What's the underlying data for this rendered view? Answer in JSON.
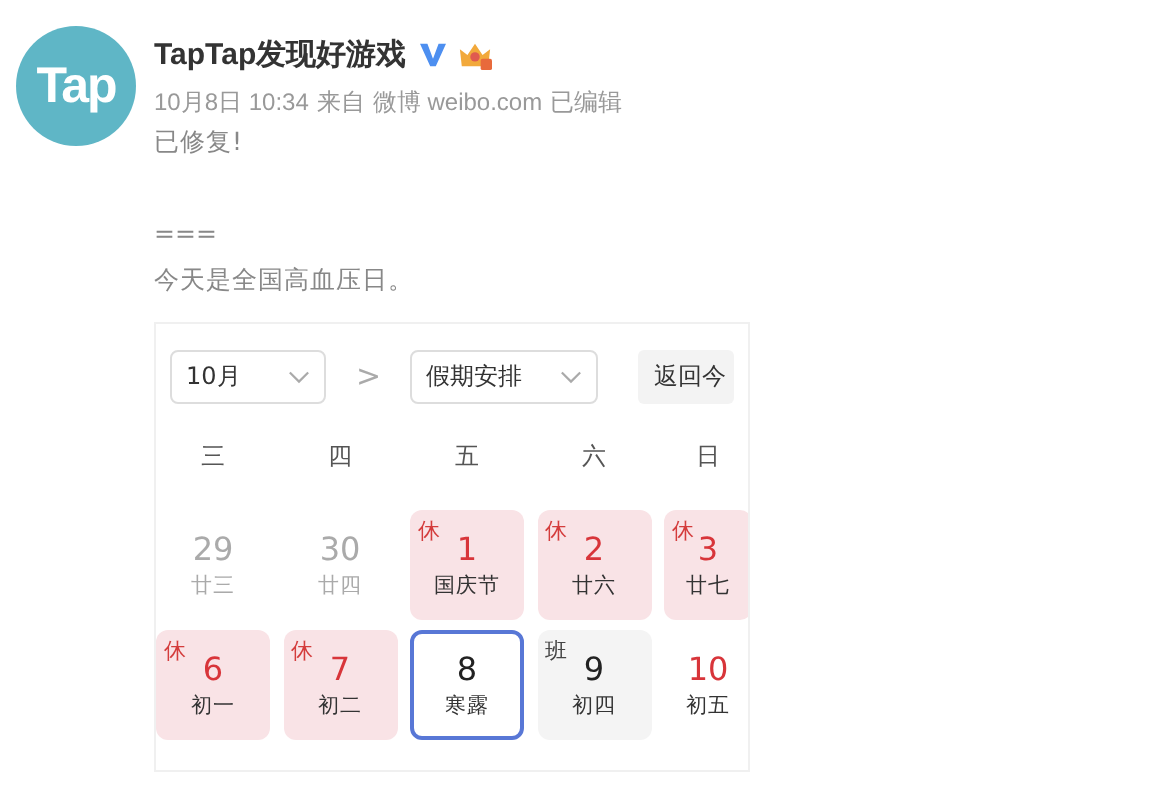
{
  "post": {
    "author": "TapTap发现好游戏",
    "avatar_text": "Tap",
    "time": "10月8日 10:34",
    "source_prefix": "来自",
    "source": "微博 weibo.com",
    "edited": "已编辑",
    "lines": [
      {
        "kind": "text",
        "text": "已修复!"
      },
      {
        "kind": "blank"
      },
      {
        "kind": "text",
        "text": "==="
      },
      {
        "kind": "text",
        "text": "今天是全国高血压日。"
      }
    ]
  },
  "calendar": {
    "month_select": "10月",
    "next": ">",
    "mode_select": "假期安排",
    "today_button": "返回今",
    "weekdays": [
      "三",
      "四",
      "五",
      "六",
      "日"
    ],
    "days": [
      {
        "day": "29",
        "lunar": "廿三",
        "kind": "other",
        "selected": false
      },
      {
        "day": "30",
        "lunar": "廿四",
        "kind": "other",
        "selected": false
      },
      {
        "day": "1",
        "lunar": "国庆节",
        "kind": "holiday",
        "badge": "休",
        "selected": false
      },
      {
        "day": "2",
        "lunar": "廿六",
        "kind": "holiday",
        "badge": "休",
        "selected": false
      },
      {
        "day": "3",
        "lunar": "廿七",
        "kind": "holiday",
        "badge": "休",
        "selected": false
      },
      {
        "day": "6",
        "lunar": "初一",
        "kind": "holiday",
        "badge": "休",
        "selected": false
      },
      {
        "day": "7",
        "lunar": "初二",
        "kind": "holiday",
        "badge": "休",
        "selected": false
      },
      {
        "day": "8",
        "lunar": "寒露",
        "kind": "normal",
        "selected": true
      },
      {
        "day": "9",
        "lunar": "初四",
        "kind": "workday",
        "badge": "班",
        "selected": false
      },
      {
        "day": "10",
        "lunar": "初五",
        "kind": "weekend",
        "selected": false
      }
    ]
  }
}
